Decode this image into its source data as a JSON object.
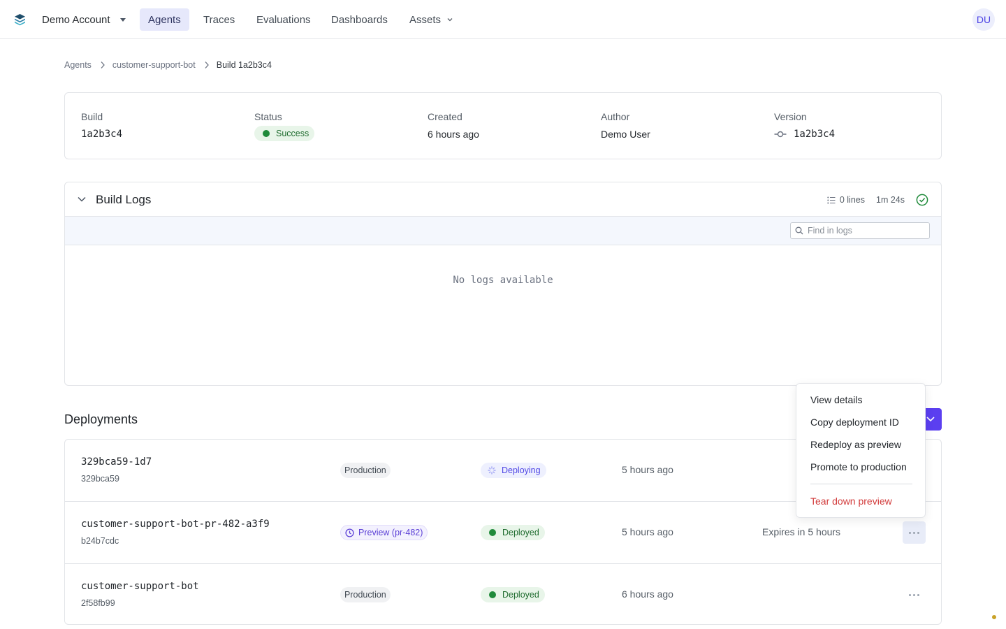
{
  "nav": {
    "account": "Demo Account",
    "items": [
      {
        "label": "Agents"
      },
      {
        "label": "Traces"
      },
      {
        "label": "Evaluations"
      },
      {
        "label": "Dashboards"
      },
      {
        "label": "Assets"
      }
    ],
    "user_initials": "DU"
  },
  "breadcrumb": [
    "Agents",
    "customer-support-bot",
    "Build 1a2b3c4"
  ],
  "build": {
    "build_label": "Build",
    "build_value": "1a2b3c4",
    "status_label": "Status",
    "status_value": "Success",
    "created_label": "Created",
    "created_value": "6 hours ago",
    "author_label": "Author",
    "author_value": "Demo User",
    "version_label": "Version",
    "version_value": "1a2b3c4"
  },
  "logs": {
    "title": "Build Logs",
    "lines": "0 lines",
    "duration": "1m 24s",
    "search_placeholder": "Find in logs",
    "empty": "No logs available"
  },
  "deployments": {
    "title": "Deployments",
    "rows": [
      {
        "name": "329bca59-1d7",
        "sha": "329bca59",
        "env": "Production",
        "status": "Deploying",
        "time": "5 hours ago",
        "expires": ""
      },
      {
        "name": "customer-support-bot-pr-482-a3f9",
        "sha": "b24b7cdc",
        "env": "Preview (pr-482)",
        "status": "Deployed",
        "time": "5 hours ago",
        "expires": "Expires in 5 hours"
      },
      {
        "name": "customer-support-bot",
        "sha": "2f58fb99",
        "env": "Production",
        "status": "Deployed",
        "time": "6 hours ago",
        "expires": ""
      }
    ]
  },
  "menu": {
    "items": [
      "View details",
      "Copy deployment ID",
      "Redeploy as preview",
      "Promote to production"
    ],
    "danger": "Tear down preview"
  },
  "colors": {
    "accent": "#5b3ff0",
    "success": "#1f8a3a",
    "danger": "#d23b3b"
  }
}
